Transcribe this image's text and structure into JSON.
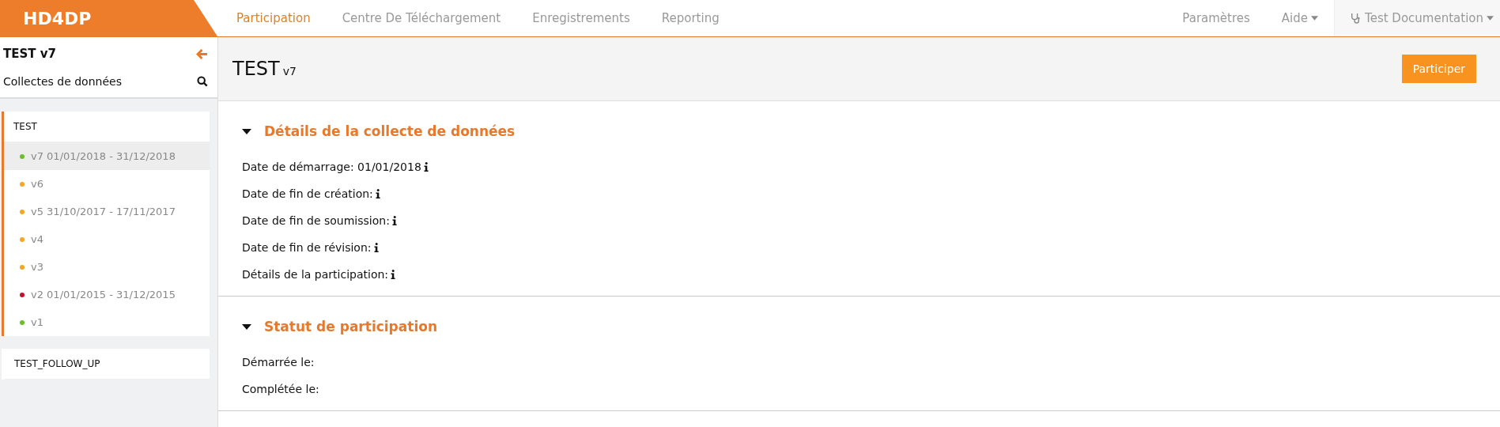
{
  "brand": "HD4DP",
  "nav": [
    {
      "label": "Participation",
      "selected": true
    },
    {
      "label": "Centre De Téléchargement",
      "selected": false
    },
    {
      "label": "Enregistrements",
      "selected": false
    },
    {
      "label": "Reporting",
      "selected": false
    }
  ],
  "nav_right": [
    {
      "label": "Paramètres",
      "kind": "link"
    },
    {
      "label": "Aide",
      "kind": "dropdown"
    },
    {
      "label": "Test Documentation",
      "kind": "user"
    }
  ],
  "sidebar": {
    "title": "TEST v7",
    "subtitle": "Collectes de données",
    "collections": [
      {
        "name": "TEST",
        "expanded": true,
        "versions": [
          {
            "label": "v7 01/01/2018 - 31/12/2018",
            "color": "#6bbf2a",
            "selected": true
          },
          {
            "label": "v6",
            "color": "#f5a623",
            "selected": false
          },
          {
            "label": "v5 31/10/2017 - 17/11/2017",
            "color": "#f5a623",
            "selected": false
          },
          {
            "label": "v4",
            "color": "#f5a623",
            "selected": false
          },
          {
            "label": "v3",
            "color": "#f5a623",
            "selected": false
          },
          {
            "label": "v2 01/01/2015 - 31/12/2015",
            "color": "#c8102e",
            "selected": false
          },
          {
            "label": "v1",
            "color": "#6bbf2a",
            "selected": false
          }
        ]
      },
      {
        "name": "TEST_FOLLOW_UP",
        "expanded": false
      }
    ]
  },
  "page": {
    "title": "TEST",
    "version": "v7",
    "button": "Participer"
  },
  "sections": [
    {
      "title": "Détails de la collecte de données",
      "fields": [
        {
          "label": "Date de démarrage: 01/01/2018",
          "info": true
        },
        {
          "label": "Date de fin de création:",
          "info": true
        },
        {
          "label": "Date de fin de soumission:",
          "info": true
        },
        {
          "label": "Date de fin de révision:",
          "info": true
        },
        {
          "label": "Détails de la participation:",
          "info": true
        }
      ]
    },
    {
      "title": "Statut de participation",
      "fields": [
        {
          "label": "Démarrée le:",
          "info": false
        },
        {
          "label": "Complétée le:",
          "info": false
        }
      ]
    }
  ]
}
